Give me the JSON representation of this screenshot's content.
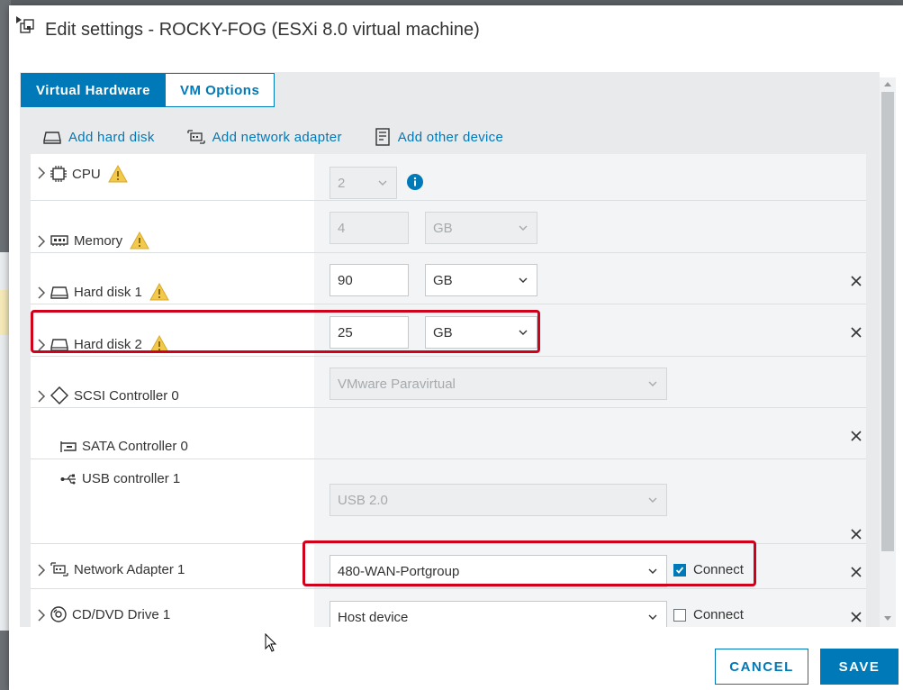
{
  "dialog": {
    "title": "Edit settings - ROCKY-FOG (ESXi 8.0 virtual machine)"
  },
  "tabs": [
    {
      "label": "Virtual Hardware",
      "active": true
    },
    {
      "label": "VM Options",
      "active": false
    }
  ],
  "actions": {
    "add_hard_disk": "Add hard disk",
    "add_network_adapter": "Add network adapter",
    "add_other_device": "Add other device"
  },
  "rows": {
    "cpu": {
      "label": "CPU",
      "value": "2"
    },
    "memory": {
      "label": "Memory",
      "value": "4",
      "unit": "GB"
    },
    "hard_disk_1": {
      "label": "Hard disk 1",
      "value": "90",
      "unit": "GB"
    },
    "hard_disk_2": {
      "label": "Hard disk 2",
      "value": "25",
      "unit": "GB"
    },
    "scsi": {
      "label": "SCSI Controller 0",
      "value": "VMware Paravirtual"
    },
    "sata": {
      "label": "SATA Controller 0"
    },
    "usb": {
      "label": "USB controller 1",
      "value": "USB 2.0"
    },
    "network": {
      "label": "Network Adapter 1",
      "value": "480-WAN-Portgroup",
      "connect_label": "Connect",
      "connected": true
    },
    "cdrom": {
      "label": "CD/DVD Drive 1",
      "value": "Host device",
      "connect_label": "Connect",
      "connected": false
    }
  },
  "buttons": {
    "cancel": "CANCEL",
    "save": "SAVE"
  },
  "colors": {
    "accent": "#0079b8",
    "highlight": "#d0021b",
    "warning": "#f2c94c"
  }
}
